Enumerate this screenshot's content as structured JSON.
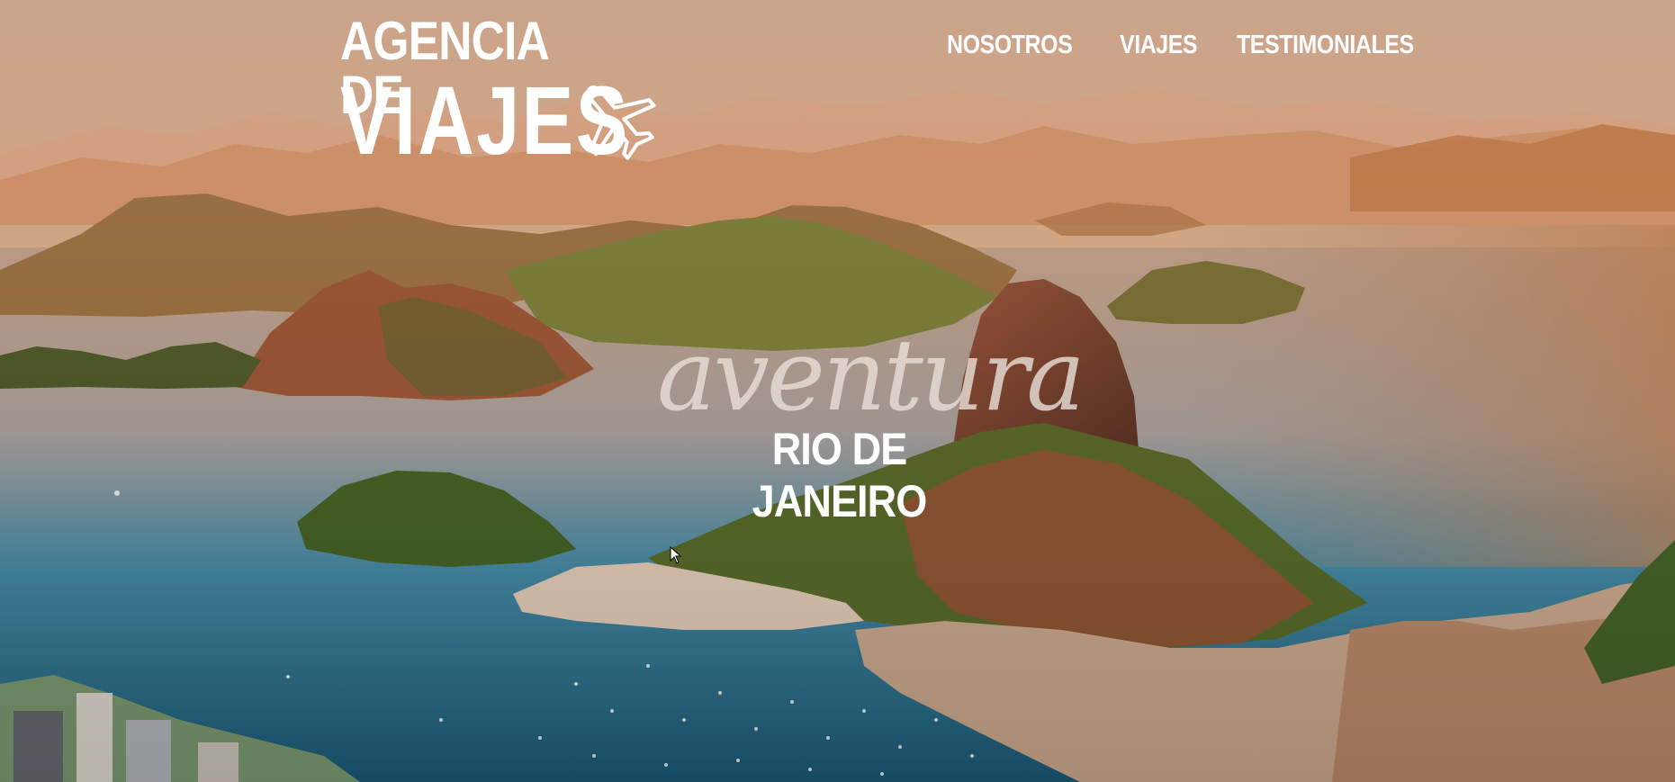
{
  "header": {
    "logo": {
      "line1": "AGENCIA DE",
      "line2": "VIAJES",
      "icon": "airplane-icon"
    },
    "nav": [
      {
        "label": "NOSOTROS"
      },
      {
        "label": "VIAJES"
      },
      {
        "label": "TESTIMONIALES"
      }
    ]
  },
  "hero": {
    "tagline": "aventura",
    "destination": "RIO DE JANEIRO",
    "background": "rio-de-janeiro-bay-photo"
  },
  "colors": {
    "text": "#ffffff",
    "tagline": "#e8ded7",
    "sky": "#d9a982",
    "water": "#2f6f8a"
  }
}
